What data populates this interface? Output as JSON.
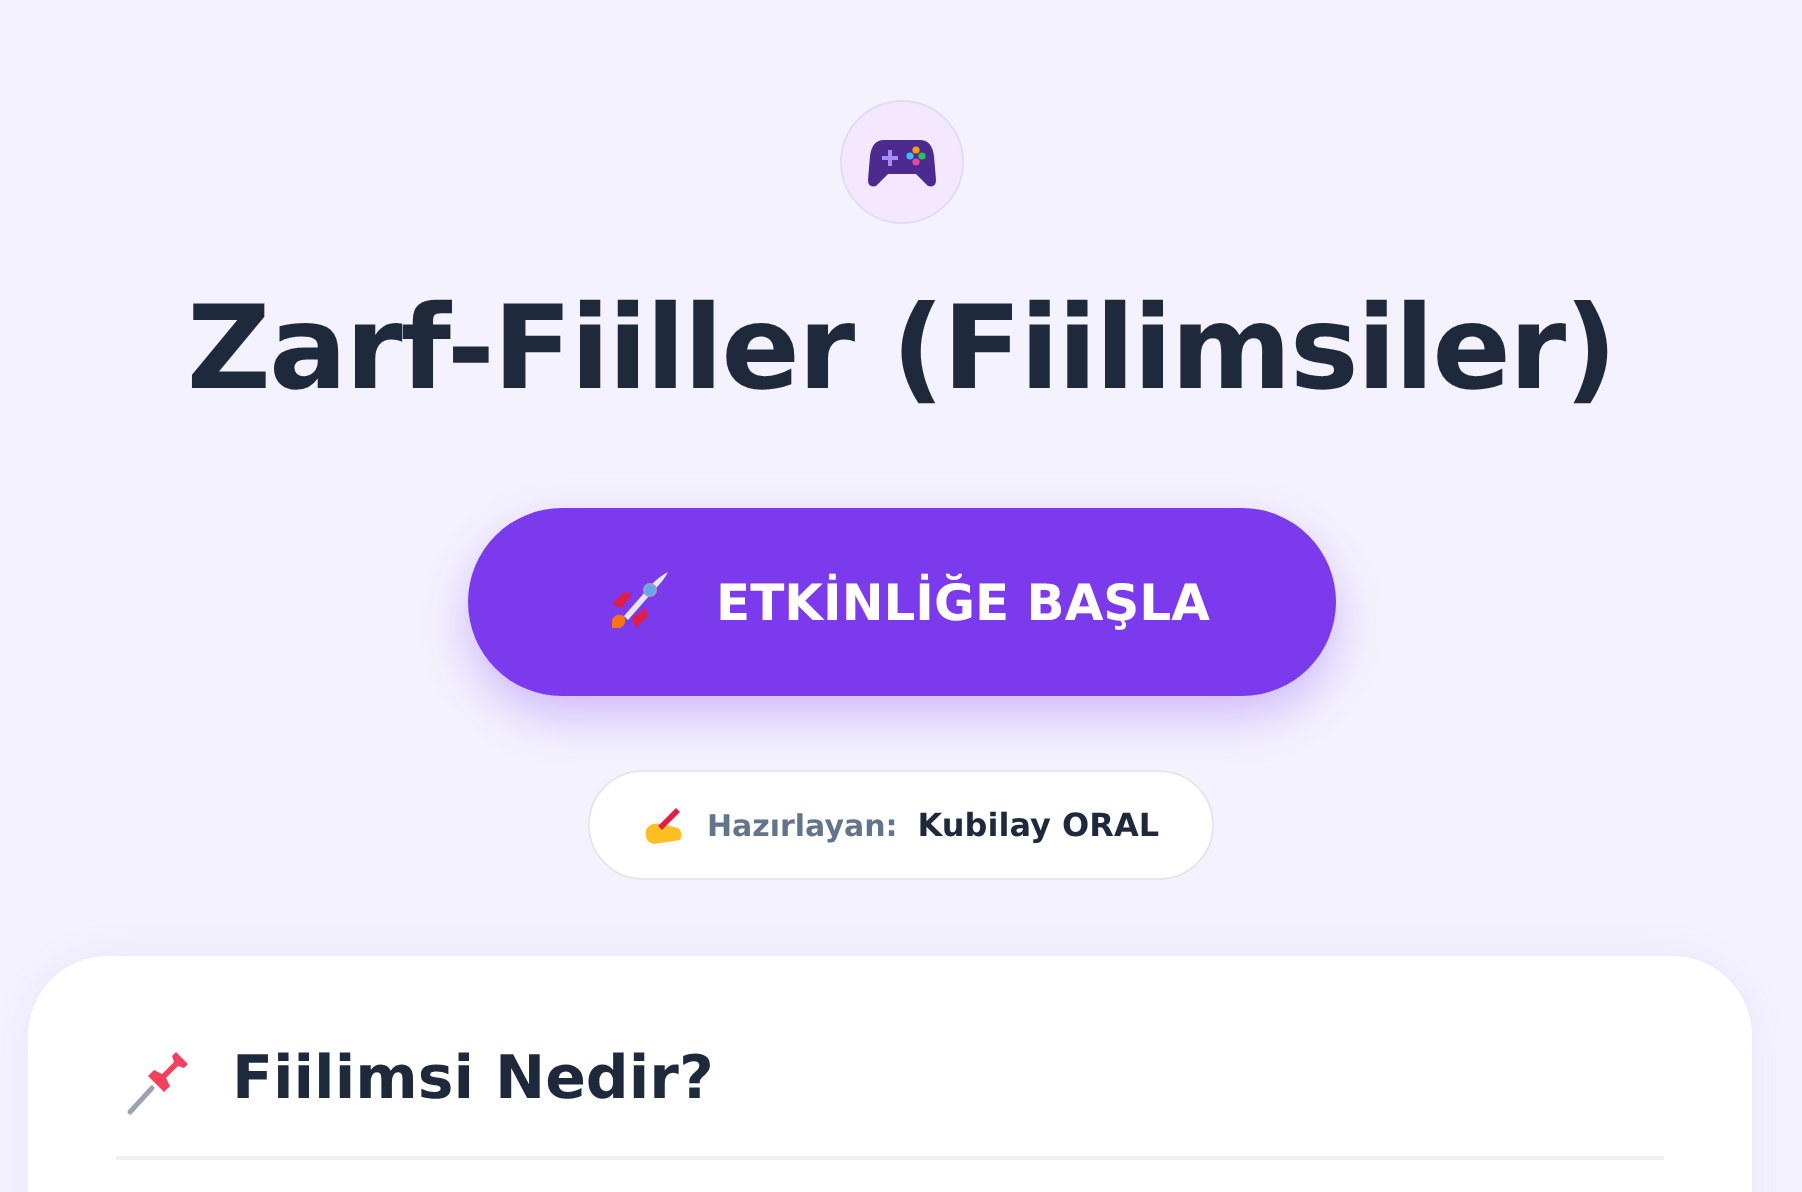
{
  "title": "Zarf-Fiiller (Fiilimsiler)",
  "start_button": {
    "label": "ETKİNLİĞE BAŞLA"
  },
  "author": {
    "label": "Hazırlayan:",
    "name": "Kubilay ORAL"
  },
  "section": {
    "heading": "Fiilimsi Nedir?"
  }
}
